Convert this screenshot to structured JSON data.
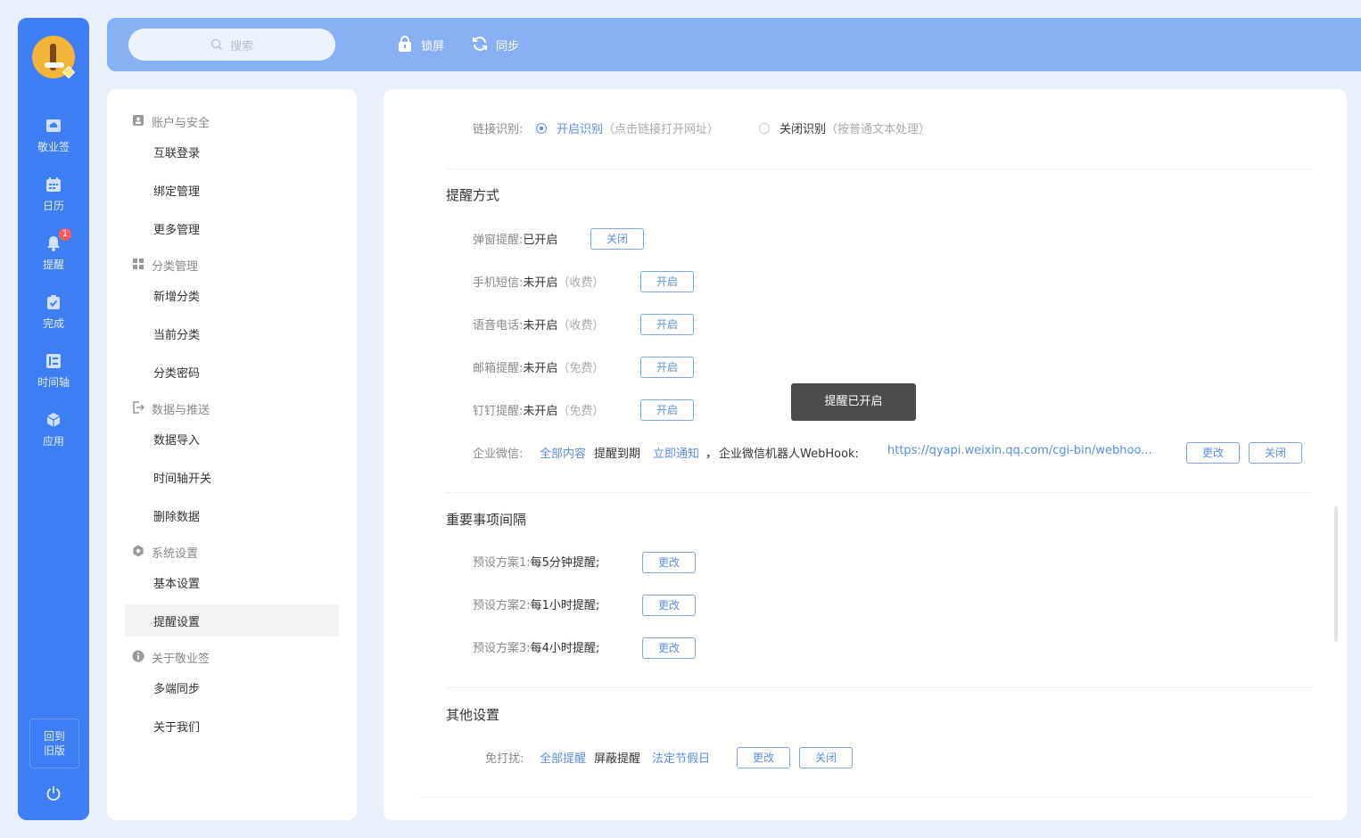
{
  "rail": {
    "items": [
      {
        "label": "敬业签",
        "icon": "cloud-note-icon"
      },
      {
        "label": "日历",
        "icon": "calendar-icon"
      },
      {
        "label": "提醒",
        "icon": "bell-icon",
        "badge": "1"
      },
      {
        "label": "完成",
        "icon": "clipboard-check-icon"
      },
      {
        "label": "时间轴",
        "icon": "timeline-icon"
      },
      {
        "label": "应用",
        "icon": "cube-icon"
      }
    ],
    "back_old": "回到旧版"
  },
  "topbar": {
    "search_placeholder": "搜索",
    "lock_label": "锁屏",
    "sync_label": "同步"
  },
  "menu": {
    "groups": [
      {
        "title": "账户与安全",
        "items": [
          "互联登录",
          "绑定管理",
          "更多管理"
        ]
      },
      {
        "title": "分类管理",
        "items": [
          "新增分类",
          "当前分类",
          "分类密码"
        ]
      },
      {
        "title": "数据与推送",
        "items": [
          "数据导入",
          "时间轴开关",
          "删除数据"
        ]
      },
      {
        "title": "系统设置",
        "items": [
          "基本设置",
          "提醒设置"
        ]
      },
      {
        "title": "关于敬业签",
        "items": [
          "多端同步",
          "关于我们"
        ]
      }
    ],
    "active_item": "提醒设置"
  },
  "link_recognition": {
    "label": "链接识别:",
    "on_label": "开启识别",
    "on_hint": "（点击链接打开网址）",
    "off_label": "关闭识别",
    "off_hint": "（按普通文本处理）"
  },
  "reminder_methods": {
    "title": "提醒方式",
    "popup": {
      "label": "弹窗提醒:",
      "status": "已开启",
      "button": "关闭"
    },
    "sms": {
      "label": "手机短信:",
      "status": "未开启",
      "note": "（收费）",
      "button": "开启"
    },
    "voice": {
      "label": "语音电话:",
      "status": "未开启",
      "note": "（收费）",
      "button": "开启"
    },
    "email": {
      "label": "邮箱提醒:",
      "status": "未开启",
      "note": "（免费）",
      "button": "开启"
    },
    "dingtalk": {
      "label": "钉钉提醒:",
      "status": "未开启",
      "note": "（免费）",
      "button": "开启"
    },
    "wecom": {
      "label": "企业微信:",
      "scope": "全部内容",
      "when_prefix": "提醒到期",
      "when": "立即通知",
      "sep": "，",
      "webhook_label": "企业微信机器人WebHook:",
      "webhook_url": "https://qyapi.weixin.qq.com/cgi-bin/webhoo...",
      "edit_button": "更改",
      "close_button": "关闭"
    }
  },
  "important_interval": {
    "title": "重要事项间隔",
    "plans": [
      {
        "label": "预设方案1:",
        "value": "每5分钟提醒;",
        "button": "更改"
      },
      {
        "label": "预设方案2:",
        "value": "每1小时提醒;",
        "button": "更改"
      },
      {
        "label": "预设方案3:",
        "value": "每4小时提醒;",
        "button": "更改"
      }
    ]
  },
  "other_settings": {
    "title": "其他设置",
    "dnd": {
      "label": "免打扰:",
      "scope": "全部提醒",
      "action": "屏蔽提醒",
      "period": "法定节假日",
      "edit_button": "更改",
      "close_button": "关闭"
    }
  },
  "toast": "提醒已开启",
  "colors": {
    "rail": "#3d7ef5",
    "topbar": "#87b0f5",
    "accent": "#5b8ee8",
    "badge": "#ff5a5a",
    "toast": "#4b4b4b"
  }
}
